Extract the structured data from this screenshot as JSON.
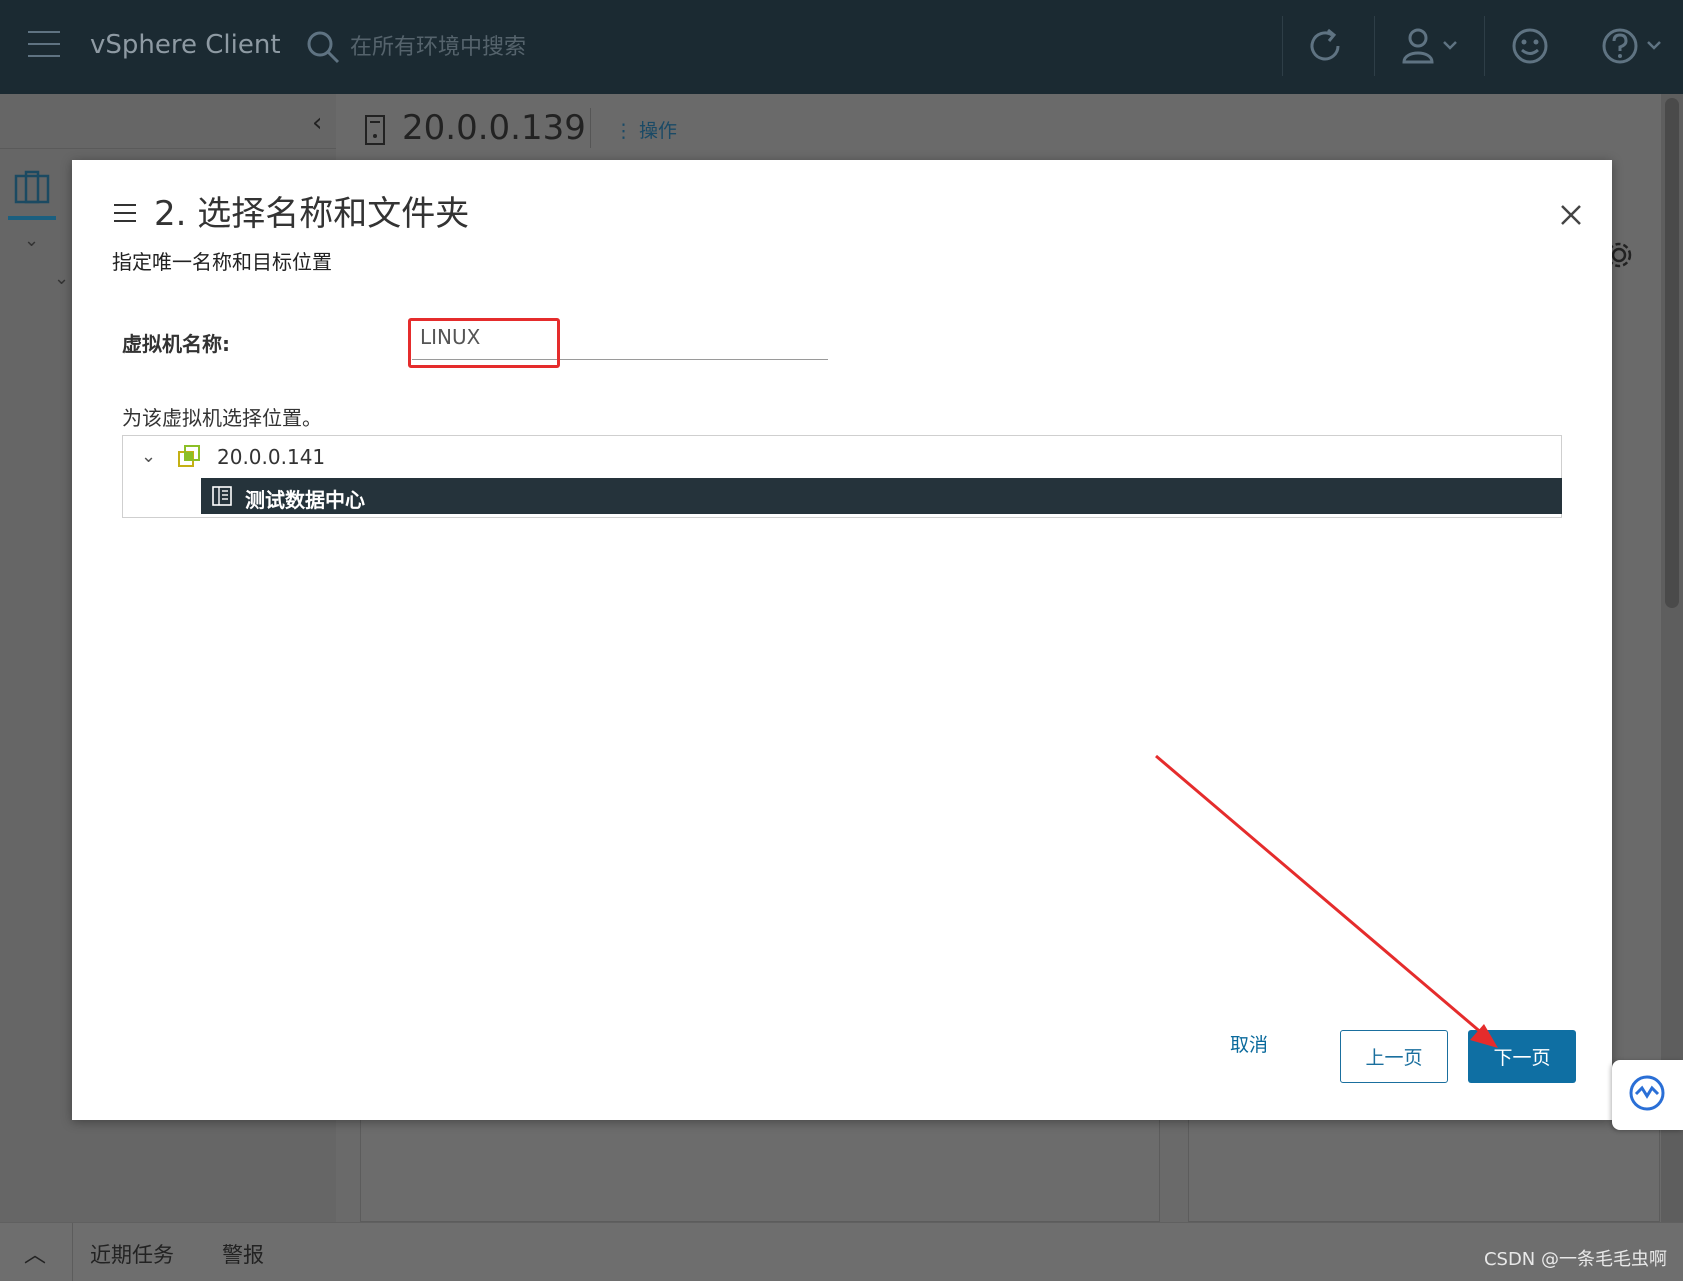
{
  "header": {
    "app_title": "vSphere Client",
    "search_placeholder": "在所有环境中搜索"
  },
  "main": {
    "object_title": "20.0.0.139",
    "actions_label": "操作"
  },
  "modal": {
    "title": "2. 选择名称和文件夹",
    "subtitle": "指定唯一名称和目标位置",
    "vm_name_label": "虚拟机名称:",
    "vm_name_value": "LINUX",
    "location_label": "为该虚拟机选择位置。",
    "tree": {
      "root_label": "20.0.0.141",
      "child_label": "测试数据中心"
    },
    "buttons": {
      "cancel": "取消",
      "back": "上一页",
      "next": "下一页"
    }
  },
  "bottom_bar": {
    "recent_tasks": "近期任务",
    "alarms": "警报"
  },
  "watermark": "CSDN @一条毛毛虫啊",
  "colors": {
    "header_bg": "#1b2a32",
    "primary_button": "#0f6fa3",
    "tree_selected_bg": "#25333b",
    "annotation_red": "#e52c2c"
  }
}
